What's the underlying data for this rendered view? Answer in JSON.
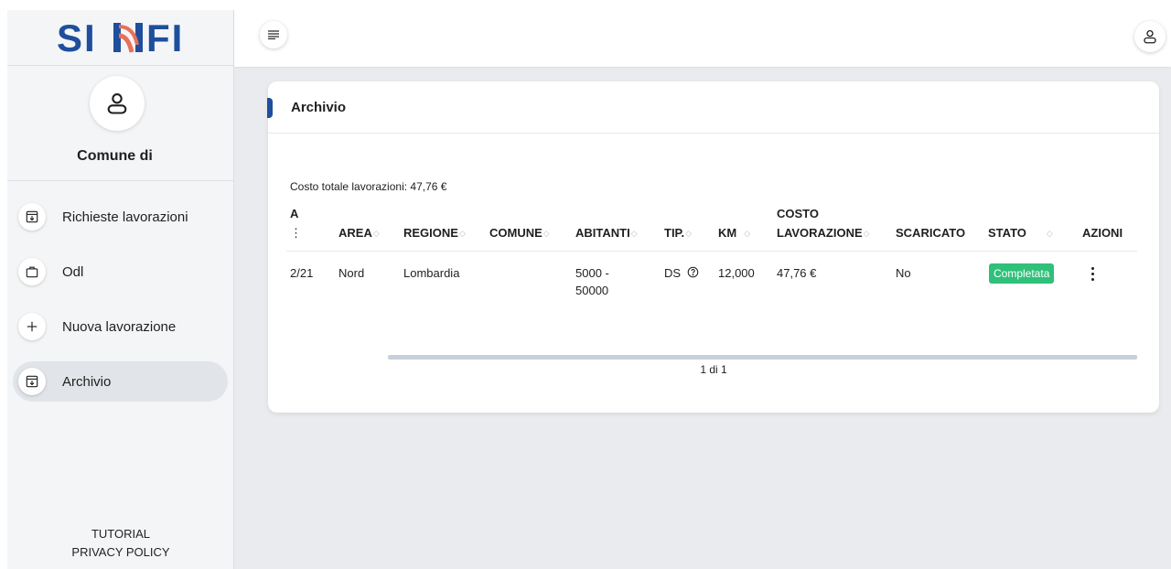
{
  "brand": {
    "logo_text": "SINFI",
    "colors": {
      "primary": "#1e4e9c",
      "accent": "#e8705a",
      "success": "#2fc07a"
    }
  },
  "sidebar": {
    "profile": {
      "name": "Comune di",
      "icon": "user-icon"
    },
    "items": [
      {
        "label": "Richieste lavorazioni",
        "icon": "archive-download-icon"
      },
      {
        "label": "Odl",
        "icon": "briefcase-icon"
      },
      {
        "label": "Nuova lavorazione",
        "icon": "plus-icon"
      },
      {
        "label": "Archivio",
        "icon": "archive-download-icon",
        "active": true
      }
    ],
    "footer": {
      "tutorial": "TUTORIAL",
      "privacy": "PRIVACY POLICY"
    }
  },
  "topbar": {
    "menu_icon": "menu-lines-icon",
    "user_icon": "user-icon"
  },
  "card": {
    "title": "Archivio",
    "cost_total": "Costo totale lavorazioni: 47,76 €",
    "columns": {
      "partial_a": "A",
      "partial_b": "⋮",
      "area": "AREA",
      "regione": "REGIONE",
      "comune": "COMUNE",
      "abitanti": "ABITANTI",
      "tip": "TIP.",
      "km": "KM",
      "costo_1": "COSTO",
      "costo_2": "LAVORAZIONE",
      "scaricato": "SCARICATO",
      "stato": "STATO",
      "azioni": "AZIONI"
    },
    "rows": [
      {
        "data": "2/21",
        "area": "Nord",
        "regione": "Lombardia",
        "comune": "",
        "abitanti_1": "5000 -",
        "abitanti_2": "50000",
        "tip": "DS",
        "km": "12,000",
        "costo": "47,76 €",
        "scaricato": "No",
        "stato": "Completata"
      }
    ],
    "pagination": "1 di 1"
  }
}
